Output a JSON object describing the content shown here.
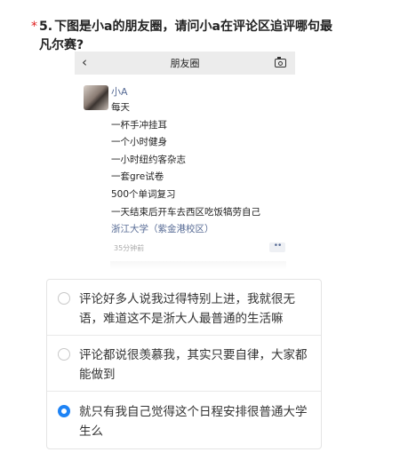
{
  "question": {
    "required_mark": "*",
    "number": "5.",
    "text": "下图是小a的朋友圈，请问小a在评论区追评哪句最凡尔赛?"
  },
  "screenshot": {
    "nav": {
      "back_icon": "chevron-left-icon",
      "back_glyph": "‹",
      "title": "朋友圈",
      "camera_icon": "camera-icon"
    },
    "post": {
      "username": "小A",
      "lines": [
        "每天",
        "一杯手冲挂耳",
        "一个小时健身",
        "一小时纽约客杂志",
        "一套gre试卷",
        "500个单词复习",
        "一天结束后开车去西区吃饭犒劳自己"
      ],
      "location": "浙江大学（紫金港校区）",
      "time": "35分钟前",
      "more_glyph": "••"
    }
  },
  "options": [
    {
      "text": "评论好多人说我过得特别上进，我就很无语，难道这不是浙大人最普通的生活嘛",
      "selected": false
    },
    {
      "text": "评论都说很羡慕我，其实只要自律，大家都能做到",
      "selected": false
    },
    {
      "text": "就只有我自己觉得这个日程安排很普通大学生么",
      "selected": true
    }
  ],
  "colors": {
    "required": "#e02020",
    "link_blue": "#576b95",
    "radio_selected": "#1e83f5"
  }
}
